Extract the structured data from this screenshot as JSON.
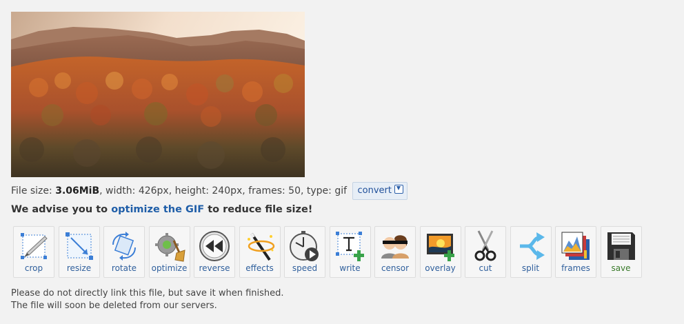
{
  "file_info": {
    "prefix": "File size: ",
    "size": "3.06MiB",
    "details": ", width: 426px, height: 240px, frames: 50, type: gif",
    "convert_label": "convert"
  },
  "advice": {
    "before": "We advise you to ",
    "link": "optimize the GIF",
    "after": " to reduce file size!"
  },
  "tools": [
    {
      "label": "crop",
      "icon": "crop-icon"
    },
    {
      "label": "resize",
      "icon": "resize-icon"
    },
    {
      "label": "rotate",
      "icon": "rotate-icon"
    },
    {
      "label": "optimize",
      "icon": "optimize-icon"
    },
    {
      "label": "reverse",
      "icon": "reverse-icon"
    },
    {
      "label": "effects",
      "icon": "effects-icon"
    },
    {
      "label": "speed",
      "icon": "speed-icon"
    },
    {
      "label": "write",
      "icon": "write-icon"
    },
    {
      "label": "censor",
      "icon": "censor-icon"
    },
    {
      "label": "overlay",
      "icon": "overlay-icon"
    },
    {
      "label": "cut",
      "icon": "cut-icon"
    },
    {
      "label": "split",
      "icon": "split-icon"
    },
    {
      "label": "frames",
      "icon": "frames-icon"
    },
    {
      "label": "save",
      "icon": "save-icon"
    }
  ],
  "notice": {
    "line1": "Please do not directly link this file, but save it when finished.",
    "line2": "The file will soon be deleted from our servers."
  },
  "colors": {
    "link": "#1f5ea8",
    "tool_label": "#2f5f9c",
    "save_label": "#3a7a2a",
    "background": "#f2f2f2"
  }
}
